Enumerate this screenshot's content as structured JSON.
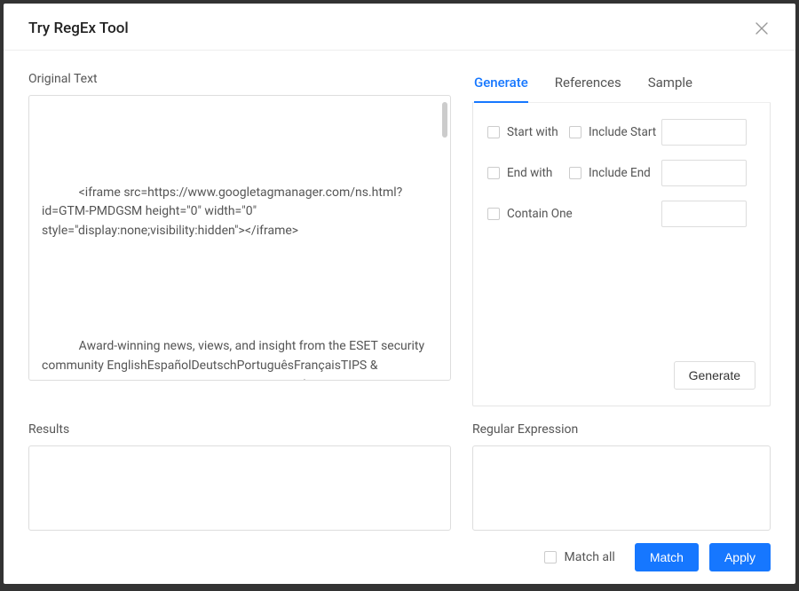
{
  "title": "Try RegEx Tool",
  "left": {
    "original_label": "Original Text",
    "original_text": "\n\n\n\n            <iframe src=https://www.googletagmanager.com/ns.html?id=GTM-PMDGSM height=\"0\" width=\"0\" style=\"display:none;visibility:hidden\"></iframe>      \n\n\n\n\n\n            Award-winning news, views, and insight from the ESET security community EnglishEspañolDeutschPortuguêsFrançaisTIPS & ADVICEBUSINESS SECURITYESET RESEARCHAbout ESET",
    "results_label": "Results"
  },
  "tabs": {
    "generate": "Generate",
    "references": "References",
    "sample": "Sample"
  },
  "generate_panel": {
    "start_with": "Start with",
    "include_start": "Include Start",
    "end_with": "End with",
    "include_end": "Include End",
    "contain_one": "Contain One",
    "generate_btn": "Generate"
  },
  "regex_label": "Regular Expression",
  "footer": {
    "match_all": "Match all",
    "match_btn": "Match",
    "apply_btn": "Apply"
  }
}
